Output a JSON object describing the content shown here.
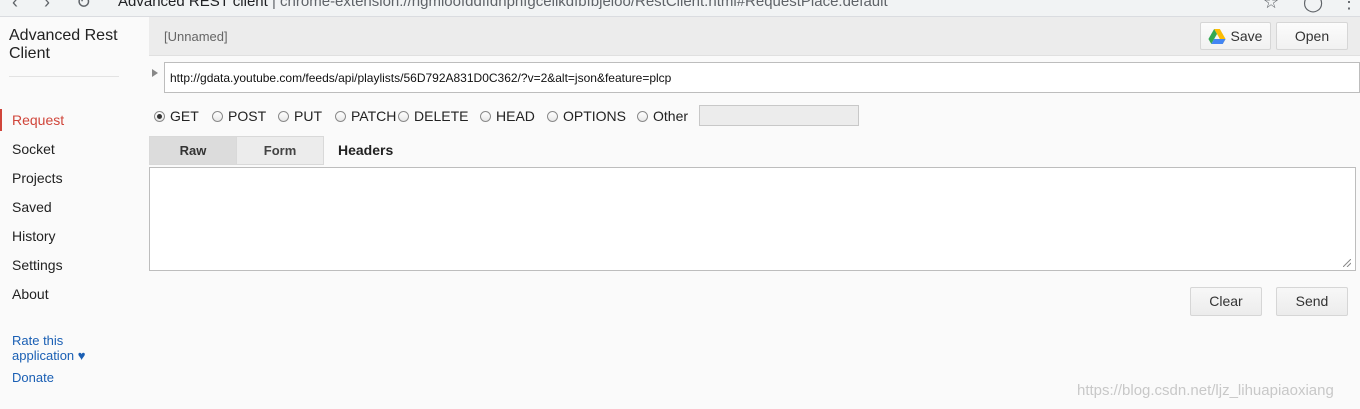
{
  "browser": {
    "url_title": "Advanced REST client",
    "url_text": "chrome-extension://hgmloofddffdnphfgcellkdfbfbjeloo/RestClient.html#RequestPlace:default"
  },
  "sidebar": {
    "app_title": "Advanced Rest Client",
    "nav_items": [
      {
        "label": "Request",
        "active": true
      },
      {
        "label": "Socket"
      },
      {
        "label": "Projects"
      },
      {
        "label": "Saved"
      },
      {
        "label": "History"
      },
      {
        "label": "Settings"
      },
      {
        "label": "About"
      }
    ],
    "rate_label": "Rate this application ♥",
    "donate_label": "Donate"
  },
  "toolbar": {
    "request_name": "[Unnamed]",
    "save_label": "Save",
    "open_label": "Open"
  },
  "request": {
    "url": "http://gdata.youtube.com/feeds/api/playlists/56D792A831D0C362/?v=2&alt=json&feature=plcp",
    "methods": [
      "GET",
      "POST",
      "PUT",
      "PATCH",
      "DELETE",
      "HEAD",
      "OPTIONS",
      "Other"
    ],
    "selected_method": "GET",
    "other_value": ""
  },
  "headers": {
    "tabs": [
      "Raw",
      "Form"
    ],
    "active_tab": "Raw",
    "label": "Headers",
    "value": ""
  },
  "actions": {
    "clear_label": "Clear",
    "send_label": "Send"
  },
  "watermark": "https://blog.csdn.net/ljz_lihuapiaoxiang",
  "colors": {
    "accent": "#d0453a",
    "link": "#1a5fb4",
    "toolbar_bg": "#ececec"
  }
}
